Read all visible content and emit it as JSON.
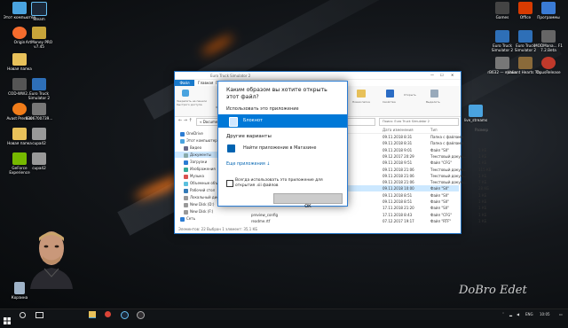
{
  "desktop": {
    "icons_left": [
      {
        "label": "Этот компьютер",
        "color": "#4aa3df",
        "icon": "pc-icon"
      },
      {
        "label": "Steam",
        "color": "#1b2838",
        "icon": "steam-icon"
      },
      {
        "label": "Origin",
        "color": "#f56c2d",
        "icon": "origin-icon"
      },
      {
        "label": "ArtMoney PRO v7.45",
        "color": "#c8a53a",
        "icon": "artmoney-icon"
      },
      {
        "label": "Новая папка",
        "color": "#e8c15a",
        "icon": "folder-icon"
      },
      {
        "label": "COD-WW2...",
        "color": "#555555",
        "icon": "game-icon"
      },
      {
        "label": "Euro Truck Simulator 2",
        "color": "#2e6fb7",
        "icon": "ets2-icon"
      },
      {
        "label": "Avast Premier",
        "color": "#f07c1a",
        "icon": "avast-icon"
      },
      {
        "label": "8306700739...",
        "color": "#777777",
        "icon": "file-icon"
      },
      {
        "label": "Новая папка",
        "color": "#e8c15a",
        "icon": "folder-icon"
      },
      {
        "label": "cupa42",
        "color": "#999999",
        "icon": "file-icon"
      },
      {
        "label": "GeForce Experience",
        "color": "#76b900",
        "icon": "geforce-icon"
      },
      {
        "label": "cupa42",
        "color": "#999999",
        "icon": "file-icon"
      }
    ],
    "icons_right": [
      {
        "label": "Games",
        "color": "#444444",
        "icon": "games-icon"
      },
      {
        "label": "Office",
        "color": "#d83b01",
        "icon": "office-icon"
      },
      {
        "label": "Программы",
        "color": "#3a7bd5",
        "icon": "programs-icon"
      },
      {
        "label": "Euro Truck Simulator 2",
        "color": "#2e6fb7",
        "icon": "ets2-icon"
      },
      {
        "label": "Euro Truck Simulator 2",
        "color": "#2e6fb7",
        "icon": "ets2-icon"
      },
      {
        "label": "MODMana... F1 7.2.Beta",
        "color": "#666666",
        "icon": "mod-icon"
      },
      {
        "label": "rB632 — ярлык",
        "color": "#777777",
        "icon": "shortcut-icon"
      },
      {
        "label": "Valiant Hearts Th...",
        "color": "#8a6a3a",
        "icon": "game-icon"
      },
      {
        "label": "OpusRelease",
        "color": "#c0392b",
        "icon": "opus-icon"
      },
      {
        "label": "live_streams",
        "color": "#4aa3df",
        "icon": "folder-icon"
      }
    ],
    "recycle_bin": "Корзина"
  },
  "explorer": {
    "title": "Euro Truck Simulator 2",
    "ribbon_tabs": [
      "Файл",
      "Главная",
      "Поделиться",
      "Вид"
    ],
    "ribbon_groups": [
      "Закрепить на панели быстрого доступа",
      "Копировать",
      "Вставить",
      "Новая папка",
      "Свойства",
      "Открыть",
      "Выделить"
    ],
    "address": "« Documents › Euro Truck Simulator 2",
    "search_placeholder": "Поиск: Euro Truck Simulator 2",
    "nav_items": [
      "OneDrive",
      "Этот компьютер",
      "Видео",
      "Документы",
      "Загрузки",
      "Изображения",
      "Музыка",
      "Объемные объекты",
      "Рабочий стол",
      "Локальный диск (C:)",
      "New Disk (D:)",
      "New Disk (F:)",
      "Сеть"
    ],
    "columns": [
      "Имя",
      "Дата изменения",
      "Тип",
      "Размер"
    ],
    "files": [
      {
        "name": "",
        "date": "09.11.2018 8:31",
        "type": "Папка с файлами",
        "size": ""
      },
      {
        "name": "",
        "date": "09.11.2018 8:31",
        "type": "Папка с файлами",
        "size": ""
      },
      {
        "name": "",
        "date": "09.11.2018 9:01",
        "type": "Файл \"SII\"",
        "size": "1 КБ"
      },
      {
        "name": "",
        "date": "09.12.2017 20:29",
        "type": "Текстовый докум...",
        "size": "1 КБ"
      },
      {
        "name": "",
        "date": "09.11.2018 9:51",
        "type": "Файл \"CFG\"",
        "size": "1 КБ"
      },
      {
        "name": "",
        "date": "09.11.2018 21:06",
        "type": "Текстовый докум...",
        "size": "115 КБ"
      },
      {
        "name": "",
        "date": "09.11.2018 21:06",
        "type": "Текстовый докум...",
        "size": "1 КБ"
      },
      {
        "name": "",
        "date": "09.11.2018 21:06",
        "type": "Текстовый докум...",
        "size": "7 КБ"
      },
      {
        "name": "",
        "date": "09.11.2018 10:00",
        "type": "Файл \"SII\"",
        "size": "28 КБ"
      },
      {
        "name": "",
        "date": "09.11.2018 8:51",
        "type": "Файл \"SII\"",
        "size": "1 КБ"
      },
      {
        "name": "",
        "date": "09.11.2018 8:51",
        "type": "Файл \"SII\"",
        "size": "1 КБ"
      },
      {
        "name": "",
        "date": "17.11.2018 21:20",
        "type": "Файл \"SII\"",
        "size": "1 КБ"
      },
      {
        "name": "preview_config",
        "date": "17.11.2018 8:43",
        "type": "Файл \"CFG\"",
        "size": "1 КБ"
      },
      {
        "name": "readme.rtf",
        "date": "07.12.2017 19:17",
        "type": "Файл \"RTF\"",
        "size": "1 КБ"
      }
    ],
    "status": "Элементов: 22   Выбран 1 элемент: 35,1 КБ"
  },
  "dialog": {
    "title": "Каким образом вы хотите открыть этот файл?",
    "use_this_app": "Использовать это приложение",
    "selected_app": "Блокнот",
    "other_options": "Другие варианты",
    "store_option": "Найти приложение в Магазине",
    "more_apps": "Еще приложения ↓",
    "always_use": "Всегда использовать это приложение для открытия .sii файлов",
    "ok": "ОК"
  },
  "taskbar": {
    "lang": "ENG",
    "time": "10:05"
  },
  "watermark": "DoBro Edet"
}
